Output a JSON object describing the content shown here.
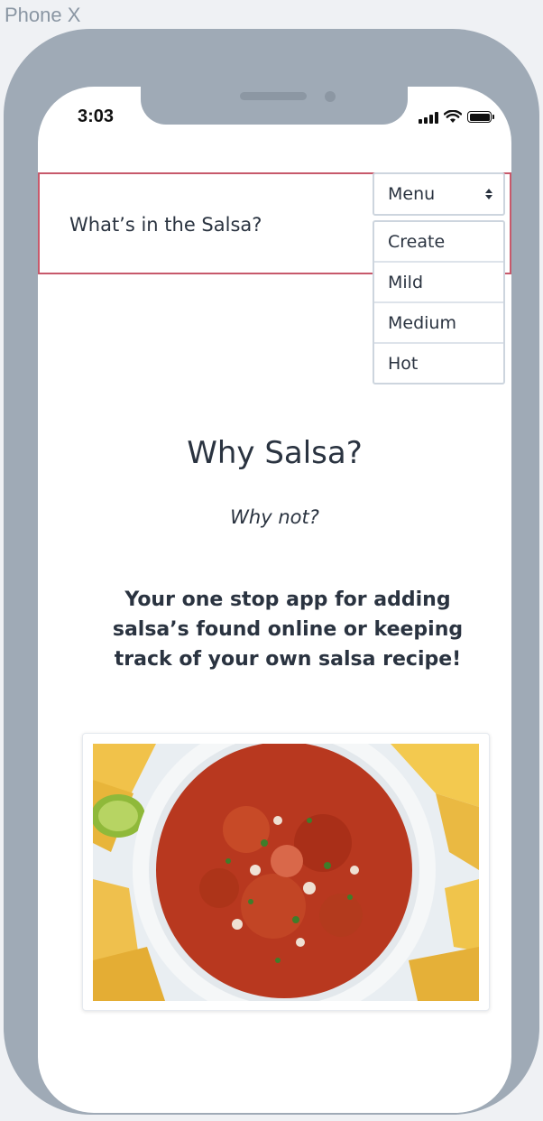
{
  "frame": {
    "label": "Phone X"
  },
  "status_bar": {
    "time": "3:03"
  },
  "header": {
    "title": "What’s in the Salsa?"
  },
  "menu": {
    "selected": "Menu",
    "options": [
      "Create",
      "Mild",
      "Medium",
      "Hot"
    ]
  },
  "hero": {
    "title": "Why Salsa?",
    "subtitle": "Why not?",
    "body": "Your one stop app for adding salsa’s found online or keeping track of your own salsa recipe!"
  },
  "colors": {
    "header_border": "#c7596b",
    "text": "#2a3340",
    "phone_frame": "#9faab6"
  },
  "icons": [
    "signal-icon",
    "wifi-icon",
    "battery-icon",
    "select-arrows-icon"
  ]
}
